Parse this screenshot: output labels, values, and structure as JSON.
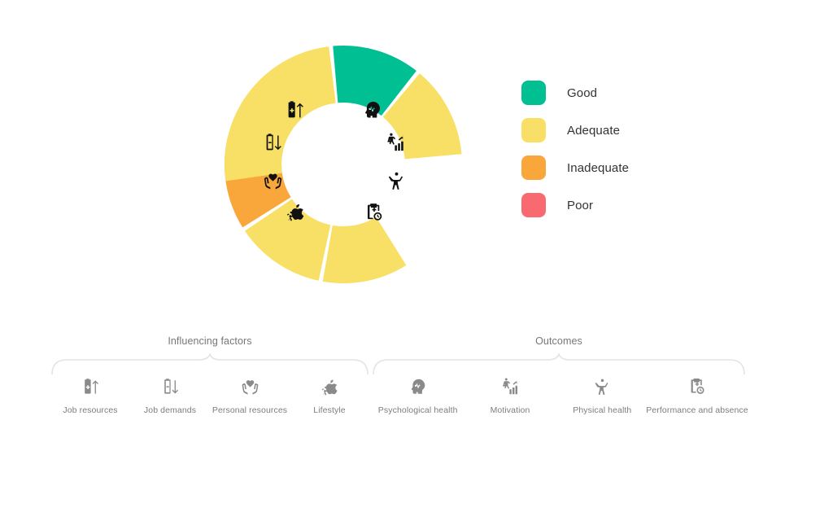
{
  "chart_data": {
    "type": "pie",
    "title": "",
    "subtitle": "",
    "variant": "split-donut-gauge",
    "legend_position": "right",
    "center": {
      "x": 422,
      "y": 202
    },
    "inner_radius": 76,
    "outer_radius": 146,
    "categories_left_label": "Influencing factors",
    "categories_right_label": "Outcomes",
    "rating_scale": [
      "Good",
      "Adequate",
      "Inadequate",
      "Poor"
    ],
    "series": [
      {
        "name": "Influencing factors",
        "side": "left",
        "segments": [
          {
            "label": "Job resources",
            "rating": "Adequate",
            "color": "#F8E066",
            "start_deg": 285,
            "end_deg": 320
          },
          {
            "label": "Job demands",
            "rating": "Inadequate",
            "color": "#F9A63A",
            "start_deg": 238,
            "end_deg": 283
          },
          {
            "label": "Personal resources",
            "rating": "Adequate",
            "color": "#F8E066",
            "start_deg": 192,
            "end_deg": 236
          },
          {
            "label": "Lifestyle",
            "rating": "Adequate",
            "color": "#F8E066",
            "start_deg": 148,
            "end_deg": 190
          }
        ]
      },
      {
        "name": "Outcomes",
        "side": "right",
        "segments": [
          {
            "label": "Psychological health",
            "rating": "Adequate",
            "color": "#F8E066",
            "start_deg": 40,
            "end_deg": 85
          },
          {
            "label": "Motivation",
            "rating": "Good",
            "color": "#00BF93",
            "start_deg": 355,
            "end_deg": 38
          },
          {
            "label": "Physical health",
            "rating": "Adequate",
            "color": "#F8E066",
            "start_deg": 308,
            "end_deg": 353
          },
          {
            "label": "Performance and absence",
            "rating": "Adequate",
            "color": "#F8E066",
            "start_deg": 262,
            "end_deg": 306
          }
        ]
      }
    ]
  },
  "legend": {
    "items": [
      {
        "label": "Good",
        "color": "#00BF93"
      },
      {
        "label": "Adequate",
        "color": "#F8E066"
      },
      {
        "label": "Inadequate",
        "color": "#F9A63A"
      },
      {
        "label": "Poor",
        "color": "#F96A70"
      }
    ]
  },
  "groups": [
    {
      "title": "Influencing factors",
      "items": [
        {
          "label": "Job resources",
          "icon": "battery-up-icon"
        },
        {
          "label": "Job demands",
          "icon": "battery-down-icon"
        },
        {
          "label": "Personal resources",
          "icon": "heart-in-hands-icon"
        },
        {
          "label": "Lifestyle",
          "icon": "apple-running-icon"
        }
      ]
    },
    {
      "title": "Outcomes",
      "items": [
        {
          "label": "Psychological health",
          "icon": "head-pulse-icon"
        },
        {
          "label": "Motivation",
          "icon": "growth-chart-person-icon"
        },
        {
          "label": "Physical health",
          "icon": "person-arms-up-icon"
        },
        {
          "label": "Performance and absence",
          "icon": "clipboard-clock-icon"
        }
      ]
    }
  ],
  "center_icons": [
    {
      "icon": "battery-up-icon",
      "for": "Job resources"
    },
    {
      "icon": "battery-down-icon",
      "for": "Job demands"
    },
    {
      "icon": "heart-in-hands-icon",
      "for": "Personal resources"
    },
    {
      "icon": "apple-running-icon",
      "for": "Lifestyle"
    },
    {
      "icon": "head-pulse-icon",
      "for": "Psychological health"
    },
    {
      "icon": "growth-chart-person-icon",
      "for": "Motivation"
    },
    {
      "icon": "person-arms-up-icon",
      "for": "Physical health"
    },
    {
      "icon": "clipboard-clock-icon",
      "for": "Performance and absence"
    }
  ],
  "colors": {
    "good": "#00BF93",
    "adequate": "#F8E066",
    "inadequate": "#F9A63A",
    "poor": "#F96A70",
    "background": "#FFFFFF",
    "text_muted": "#7D7D7D",
    "icon_dark": "#111111",
    "icon_muted": "#8A8A8A",
    "brace": "#E2E2E2"
  }
}
